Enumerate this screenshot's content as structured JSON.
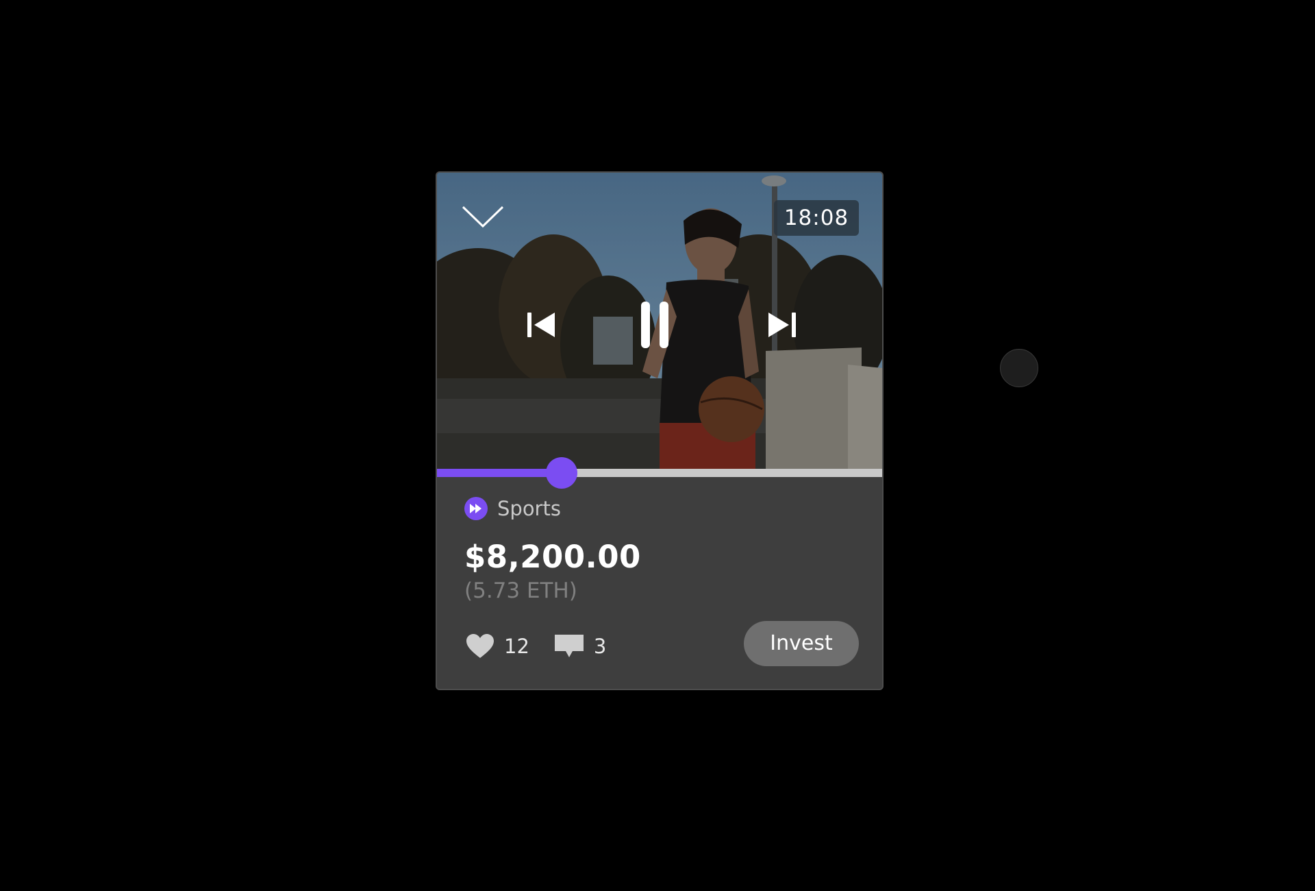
{
  "player": {
    "timestamp": "18:08",
    "progress_fraction": 0.28,
    "accent_color": "#7b4df2",
    "icons": {
      "collapse": "chevron-down-icon",
      "previous": "skip-previous-icon",
      "pause": "pause-icon",
      "next": "skip-next-icon"
    }
  },
  "listing": {
    "category": "Sports",
    "category_icon": "fast-forward-icon",
    "price": "$8,200.00",
    "eth_price": "(5.73 ETH)",
    "likes": "12",
    "comments": "3",
    "like_icon": "heart-icon",
    "comment_icon": "comment-icon",
    "invest_label": "Invest"
  }
}
